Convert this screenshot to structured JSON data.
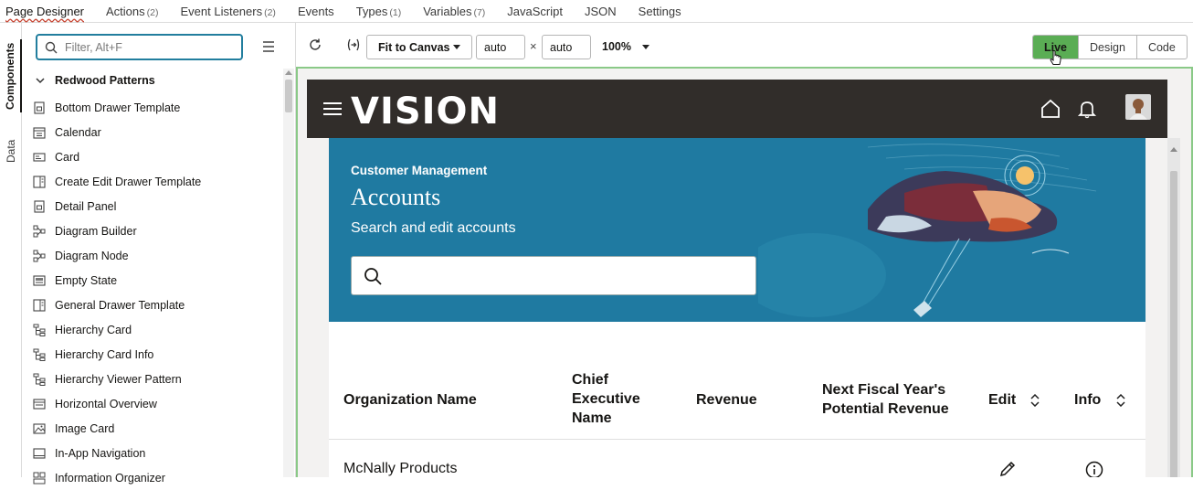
{
  "tabs": [
    {
      "label": "Page Designer",
      "count": ""
    },
    {
      "label": "Actions",
      "count": "(2)"
    },
    {
      "label": "Event Listeners",
      "count": "(2)"
    },
    {
      "label": "Events",
      "count": ""
    },
    {
      "label": "Types",
      "count": "(1)"
    },
    {
      "label": "Variables",
      "count": "(7)"
    },
    {
      "label": "JavaScript",
      "count": ""
    },
    {
      "label": "JSON",
      "count": ""
    },
    {
      "label": "Settings",
      "count": ""
    }
  ],
  "side_tabs": {
    "components": "Components",
    "data": "Data"
  },
  "palette": {
    "filter_placeholder": "Filter, Alt+F",
    "group": "Redwood Patterns",
    "items": [
      {
        "label": "Bottom Drawer Template",
        "icon": "template-icon"
      },
      {
        "label": "Calendar",
        "icon": "calendar-icon"
      },
      {
        "label": "Card",
        "icon": "card-icon"
      },
      {
        "label": "Create Edit Drawer Template",
        "icon": "drawer-icon"
      },
      {
        "label": "Detail Panel",
        "icon": "template-icon"
      },
      {
        "label": "Diagram Builder",
        "icon": "diagram-icon"
      },
      {
        "label": "Diagram Node",
        "icon": "diagram-icon"
      },
      {
        "label": "Empty State",
        "icon": "empty-state-icon"
      },
      {
        "label": "General Drawer Template",
        "icon": "drawer-icon"
      },
      {
        "label": "Hierarchy Card",
        "icon": "hierarchy-icon"
      },
      {
        "label": "Hierarchy Card Info",
        "icon": "hierarchy-icon"
      },
      {
        "label": "Hierarchy Viewer Pattern",
        "icon": "hierarchy-icon"
      },
      {
        "label": "Horizontal Overview",
        "icon": "overview-icon"
      },
      {
        "label": "Image Card",
        "icon": "image-icon"
      },
      {
        "label": "In-App Navigation",
        "icon": "navigation-icon"
      },
      {
        "label": "Information Organizer",
        "icon": "organizer-icon"
      }
    ]
  },
  "toolbar": {
    "fit_label": "Fit to Canvas",
    "width": "auto",
    "times": "×",
    "height": "auto",
    "zoom": "100%",
    "modes": [
      "Live",
      "Design",
      "Code"
    ]
  },
  "app": {
    "logo": "VISION",
    "eyebrow": "Customer Management",
    "title": "Accounts",
    "subtitle": "Search and edit accounts"
  },
  "table": {
    "headers": {
      "org": "Organization Name",
      "ceo_1": "Chief",
      "ceo_2": "Executive",
      "ceo_3": "Name",
      "revenue": "Revenue",
      "next_1": "Next Fiscal Year's",
      "next_2": "Potential Revenue",
      "edit": "Edit",
      "info": "Info"
    },
    "rows": [
      {
        "org": "McNally Products"
      }
    ]
  },
  "colors": {
    "accent": "#227e9e",
    "live": "#5aad54",
    "appbar": "#312d2a",
    "hero": "#1f7aa1"
  }
}
